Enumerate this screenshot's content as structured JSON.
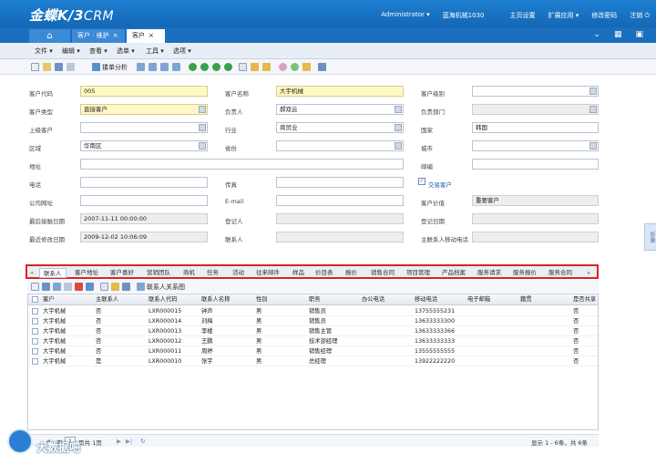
{
  "app": {
    "logo_main": "金蝶K/3",
    "logo_sub": "CRM",
    "user": "Administrator ▾",
    "org": "蓝海机械1030",
    "links": [
      "主页设置",
      "扩展应用 ▾",
      "修改密码",
      "注销 ⏻"
    ]
  },
  "tabs": [
    {
      "label": "⌂"
    },
    {
      "label": "客户 · 维护",
      "close": "×"
    },
    {
      "label": "客户",
      "close": "×"
    }
  ],
  "tabbar_icons": [
    "double-chevron-down-icon",
    "grid-icon",
    "window-icon"
  ],
  "menu": [
    "文件 ▾",
    "编辑 ▾",
    "查看 ▾",
    "选单 ▾",
    "工具 ▾",
    "选项 ▾"
  ],
  "toolbar": {
    "label": "搂单分析"
  },
  "form": {
    "fields": [
      {
        "label": "客户代码",
        "value": "005",
        "style": "req",
        "lookup": false
      },
      {
        "label": "客户名称",
        "value": "大宇机械",
        "style": "req",
        "lookup": false
      },
      {
        "label": "客户级别",
        "value": "",
        "style": "",
        "lookup": true
      },
      {
        "label": "客户类型",
        "value": "直接客户",
        "style": "req",
        "lookup": true
      },
      {
        "label": "负责人",
        "value": "郝双云",
        "style": "",
        "lookup": true
      },
      {
        "label": "负责部门",
        "value": "",
        "style": "ro",
        "lookup": true
      },
      {
        "label": "上级客户",
        "value": "",
        "style": "",
        "lookup": true
      },
      {
        "label": "行业",
        "value": "商贸业",
        "style": "",
        "lookup": true
      },
      {
        "label": "国家",
        "value": "韩国",
        "style": "",
        "lookup": false
      },
      {
        "label": "区域",
        "value": "华南区",
        "style": "",
        "lookup": true
      },
      {
        "label": "省份",
        "value": "",
        "style": "",
        "lookup": true
      },
      {
        "label": "城市",
        "value": "",
        "style": "",
        "lookup": true
      },
      {
        "label": "地址",
        "value": "",
        "style": "",
        "lookup": false
      },
      {
        "label": "邮编",
        "value": "",
        "style": "",
        "lookup": false
      },
      {
        "label": "电话",
        "value": "",
        "style": "",
        "lookup": false
      },
      {
        "label": "传真",
        "value": "",
        "style": "",
        "lookup": false
      },
      {
        "label": "交易客户",
        "value": "✓",
        "style": "check",
        "lookup": false
      },
      {
        "label": "公司网址",
        "value": "",
        "style": "",
        "lookup": false
      },
      {
        "label": "E-mail",
        "value": "",
        "style": "",
        "lookup": false
      },
      {
        "label": "客户价值",
        "value": "重要客户",
        "style": "ro",
        "lookup": false
      },
      {
        "label": "最后接触日期",
        "value": "2007-11-11 00:00:00",
        "style": "ro",
        "lookup": false
      },
      {
        "label": "登记人",
        "value": "",
        "style": "ro",
        "lookup": false
      },
      {
        "label": "登记日期",
        "value": "",
        "style": "ro",
        "lookup": false
      },
      {
        "label": "最近修改日期",
        "value": "2009-12-02 10:06:09",
        "style": "ro",
        "lookup": false
      },
      {
        "label": "联系人",
        "value": "",
        "style": "ro",
        "lookup": false
      },
      {
        "label": "主联系人移动电话",
        "value": "",
        "style": "ro",
        "lookup": false
      }
    ]
  },
  "subtabs": [
    "联系人",
    "客户地址",
    "客户喜好",
    "营销团队",
    "商机",
    "任务",
    "活动",
    "往来邮件",
    "样品",
    "价目表",
    "报价",
    "销售合同",
    "项目管理",
    "产品档案",
    "服务请求",
    "服务报价",
    "服务合同"
  ],
  "grid_toolbar_label": "联系人关系图",
  "grid": {
    "columns": [
      "客户",
      "主联系人",
      "联系人代码",
      "联系人名称",
      "性别",
      "职务",
      "办公电话",
      "移动电话",
      "电子邮箱",
      "籍贯",
      "是否共享"
    ],
    "rows": [
      [
        "大宇机械",
        "否",
        "LXR000015",
        "钟声",
        "男",
        "销售员",
        "",
        "13755555231",
        "",
        "",
        "否"
      ],
      [
        "大宇机械",
        "否",
        "LXR000014",
        "刘梅",
        "男",
        "销售员",
        "",
        "13633333300",
        "",
        "",
        "否"
      ],
      [
        "大宇机械",
        "否",
        "LXR000013",
        "李楼",
        "男",
        "销售主管",
        "",
        "13633333366",
        "",
        "",
        "否"
      ],
      [
        "大宇机械",
        "否",
        "LXR000012",
        "王鹏",
        "男",
        "技术部经理",
        "",
        "13633333333",
        "",
        "",
        "否"
      ],
      [
        "大宇机械",
        "否",
        "LXR000011",
        "周婷",
        "男",
        "销售经理",
        "",
        "13555555555",
        "",
        "",
        "否"
      ],
      [
        "大宇机械",
        "是",
        "LXR000010",
        "张宇",
        "男",
        "总经理",
        "",
        "13922222220",
        "",
        "",
        "否"
      ]
    ]
  },
  "status": {
    "page_prefix": "第",
    "page_value": "1",
    "page_suffix": "页共 1页",
    "summary": "显示 1 - 6条，共 6条"
  },
  "side_handle": "折叠",
  "watermark": "大数据吧"
}
